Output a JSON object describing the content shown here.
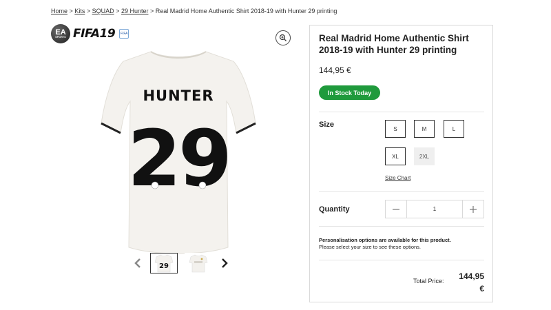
{
  "breadcrumb": {
    "items": [
      "Home",
      "Kits",
      "SQUAD",
      "29 Hunter"
    ],
    "separator": ">",
    "current": "Real Madrid Home Authentic Shirt 2018-19 with Hunter 29 printing"
  },
  "gallery": {
    "logo_ea": "EA SPORTS",
    "logo_text": "FIFA19",
    "logo_badge": "FIFA",
    "shirt_name": "HUNTER",
    "shirt_number": "29",
    "thumb_number": "29",
    "icons": {
      "zoom": "zoom-icon",
      "prev": "chevron-left-icon",
      "next": "chevron-right-icon"
    }
  },
  "product": {
    "title": "Real Madrid Home Authentic Shirt 2018-19 with Hunter 29 printing",
    "price": "144,95 €",
    "stock_badge": "In Stock Today",
    "size_label": "Size",
    "sizes": [
      "S",
      "M",
      "L",
      "XL",
      "2XL"
    ],
    "size_chart": "Size Chart",
    "quantity_label": "Quantity",
    "quantity_value": "1",
    "personalisation_heading": "Personalisation options are available for this product.",
    "personalisation_note": "Please select your size to see these options.",
    "total_label": "Total Price:",
    "total_amount": "144,95",
    "total_currency": "€"
  },
  "colors": {
    "stock_green": "#1f9a3c",
    "border": "#d9d9d9"
  }
}
